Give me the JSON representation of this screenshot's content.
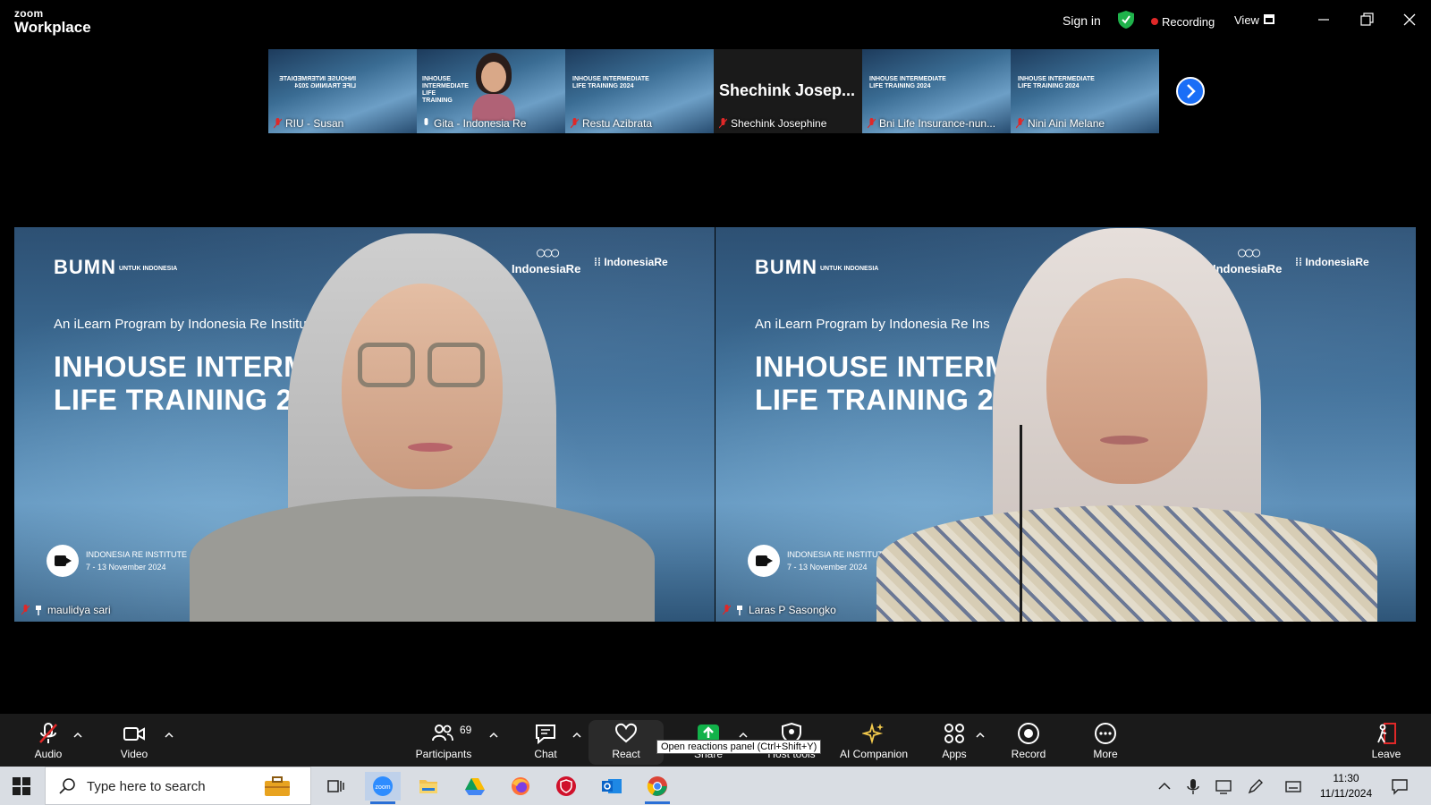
{
  "app": {
    "brand_top": "zoom",
    "brand_bottom": "Workplace",
    "sign_in": "Sign in",
    "recording": "Recording",
    "view": "View"
  },
  "thumbnails": [
    {
      "name": "RIU - Susan",
      "type": "slide",
      "slide_title": "INHOUSE INTERMEDIATE LIFE TRAINING 2024"
    },
    {
      "name": "Gita - Indonesia Re",
      "type": "video",
      "slide_title": "INHOUSE INTERMEDIATE LIFE TRAINING"
    },
    {
      "name": "Restu Azibrata",
      "type": "slide",
      "slide_title": "INHOUSE INTERMEDIATE LIFE TRAINING 2024"
    },
    {
      "name": "Shechink Josephine",
      "type": "avatar",
      "display": "Shechink  Josep..."
    },
    {
      "name": "Bni Life Insurance-nun...",
      "type": "slide",
      "slide_title": "INHOUSE INTERMEDIATE LIFE TRAINING 2024"
    },
    {
      "name": "Nini Aini Melane",
      "type": "slide",
      "slide_title": "INHOUSE INTERMEDIATE LIFE TRAINING 2024"
    }
  ],
  "main_videos": [
    {
      "name": "maulidya sari",
      "bumn": "BUMN",
      "bumn_sub": "UNTUK INDONESIA",
      "ire": "IndonesiaRe",
      "iri": "IndonesiaRe",
      "program": "An iLearn Program by Indonesia Re Institute",
      "headline1": "INHOUSE INTERME",
      "headline2": "LIFE TRAINING 202",
      "institute": "INDONESIA RE INSTITUTE",
      "dates": "7 - 13 November 2024"
    },
    {
      "name": "Laras P Sasongko",
      "bumn": "BUMN",
      "bumn_sub": "UNTUK INDONESIA",
      "ire": "IndonesiaRe",
      "iri": "IndonesiaRe",
      "program": "An iLearn Program by Indonesia Re Ins",
      "headline1": "INHOUSE INTERM",
      "headline2": "LIFE TRAINING 20",
      "institute": "INDONESIA RE INSTITUT",
      "dates": "7 - 13 November 2024"
    }
  ],
  "toolbar": {
    "audio": "Audio",
    "video": "Video",
    "participants": "Participants",
    "participants_count": "69",
    "chat": "Chat",
    "react": "React",
    "share": "Share",
    "host_tools": "Host tools",
    "ai_companion": "AI Companion",
    "apps": "Apps",
    "record": "Record",
    "more": "More",
    "leave": "Leave",
    "tooltip": "Open reactions panel (Ctrl+Shift+Y)"
  },
  "taskbar": {
    "search_placeholder": "Type here to search",
    "time": "11:30",
    "date": "11/11/2024"
  },
  "colors": {
    "background": "#000000",
    "toolbar": "#1a1a1a",
    "accent_blue": "#1a6ef7",
    "recording_red": "#e02828",
    "share_green": "#12b24a",
    "muted_red": "#e02828",
    "taskbar": "#d9dde3"
  }
}
